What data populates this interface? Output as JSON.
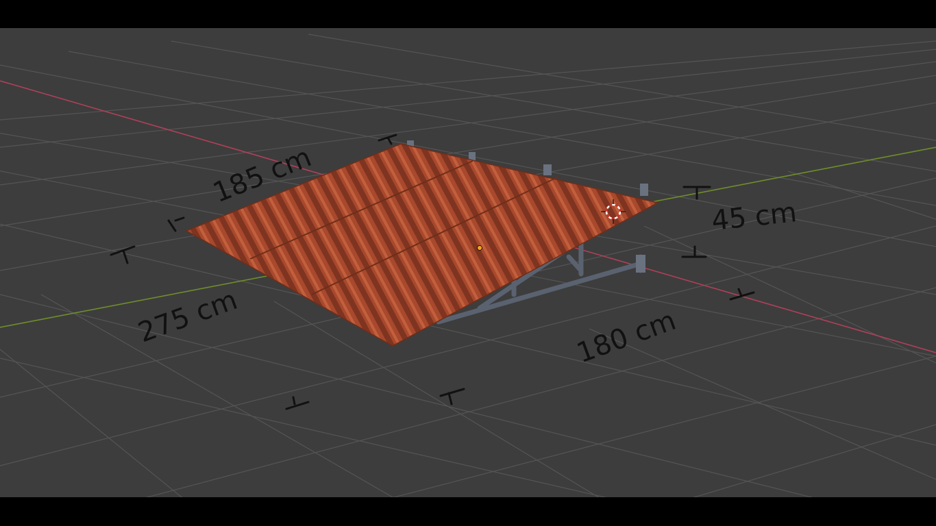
{
  "viewport": {
    "background": "#3d3d3d",
    "grid_color": "#555555",
    "x_axis_color": "#b0405a",
    "y_axis_color": "#6f8f2a"
  },
  "object": {
    "roof_color": "#a8482c",
    "frame_color": "#5a6270",
    "origin_color": "#f2a020",
    "cursor_color": "#c8322a"
  },
  "annotations": {
    "depth_top": "185 cm",
    "height": "45 cm",
    "width_left": "275 cm",
    "depth_bottom": "180 cm"
  }
}
